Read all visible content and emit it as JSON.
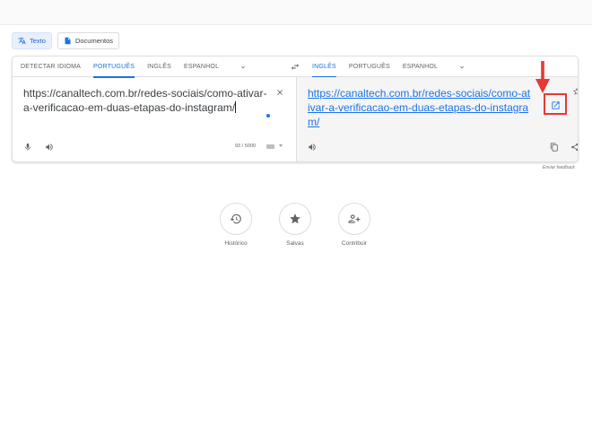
{
  "modes": {
    "text_label": "Texto",
    "documents_label": "Documentos"
  },
  "source_langs": [
    "DETECTAR IDIOMA",
    "PORTUGUÊS",
    "INGLÊS",
    "ESPANHOL"
  ],
  "target_langs": [
    "INGLÊS",
    "PORTUGUÊS",
    "ESPANHOL"
  ],
  "source": {
    "text": "https://canaltech.com.br/redes-sociais/como-ativar-a-verificacao-em-duas-etapas-do-instagram/",
    "char_count": "93 / 5000"
  },
  "target": {
    "text": "https://canaltech.com.br/redes-sociais/como-ativar-a-verificacao-em-duas-etapas-do-instagram/"
  },
  "feedback_label": "Enviar feedback",
  "shortcuts": [
    {
      "label": "Histórico",
      "icon": "history-icon"
    },
    {
      "label": "Salvas",
      "icon": "star-icon"
    },
    {
      "label": "Contribuir",
      "icon": "contribute-icon"
    }
  ],
  "colors": {
    "accent": "#1a73e8",
    "annotation": "#e53935"
  }
}
